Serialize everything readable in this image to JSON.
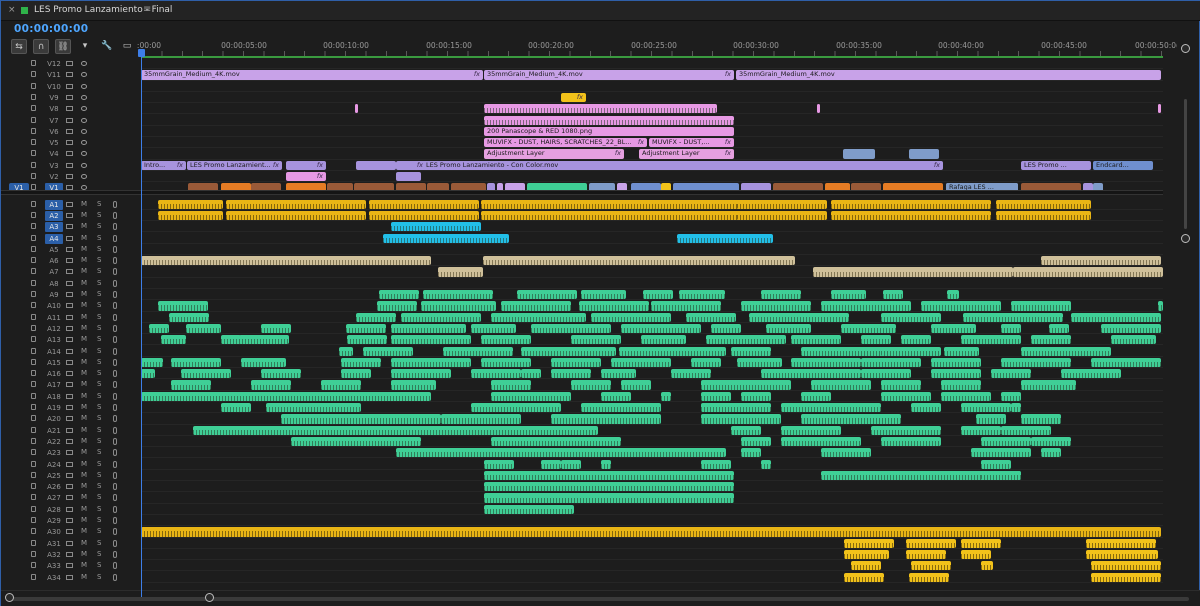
{
  "sequence": {
    "title": "LES Promo Lanzamiento - Final",
    "timecode": "00:00:00:00"
  },
  "ruler": {
    "ticks": [
      ":00:00",
      "00:00:05:00",
      "00:00:10:00",
      "00:00:15:00",
      "00:00:20:00",
      "00:00:25:00",
      "00:00:30:00",
      "00:00:35:00",
      "00:00:40:00",
      "00:00:45:00",
      "00:00:50:0("
    ]
  },
  "video_tracks": [
    "V12",
    "V11",
    "V10",
    "V9",
    "V8",
    "V7",
    "V6",
    "V5",
    "V4",
    "V3",
    "V2",
    "V1"
  ],
  "audio_tracks": [
    "A1",
    "A2",
    "A3",
    "A4",
    "A5",
    "A6",
    "A7",
    "A8",
    "A9",
    "A10",
    "A11",
    "A12",
    "A13",
    "A14",
    "A15",
    "A16",
    "A17",
    "A18",
    "A19",
    "A20",
    "A21",
    "A22",
    "A23",
    "A24",
    "A25",
    "A26",
    "A27",
    "A28",
    "A29",
    "A30",
    "A31",
    "A32",
    "A33",
    "A34"
  ],
  "selected_tracks": [
    "V1",
    "A1",
    "A2",
    "A3",
    "A4"
  ],
  "source_patch": "V1",
  "audio_toggles": {
    "mute": "M",
    "solo": "S"
  },
  "clip_labels": {
    "grain1": "35mmGrain_Medium_4K.mov",
    "grain2": "35mmGrain_Medium_4K.mov",
    "grain3": "35mmGrain_Medium_4K.mov",
    "panascope": "200 Panascope & RED 1080.png",
    "muvi1": "MUVIFX - DUST, HAIRS, SCRATCHES_22_BL...",
    "muvi2": "MUVIFX - DUST,...",
    "adj1": "Adjustment Layer",
    "adj2": "Adjustment Layer",
    "intro": "Intro...",
    "les1": "LES Promo Lanzamient...",
    "lescolor": "LES Promo Lanzamiento - Con Color.mov",
    "les2": "LES Promo ...",
    "endcard": "Endcard...",
    "rafaga": "Rafaga LES ...",
    "fx": "fx"
  },
  "colors": {
    "accent": "#4ea6ff",
    "video_clip": "#c8a2e8",
    "audio_green": "#3fcf96",
    "audio_yellow": "#f2c21a",
    "audio_cyan": "#22bfe8",
    "audio_tan": "#cfc09a",
    "sequence_label": "#2fb34a"
  }
}
